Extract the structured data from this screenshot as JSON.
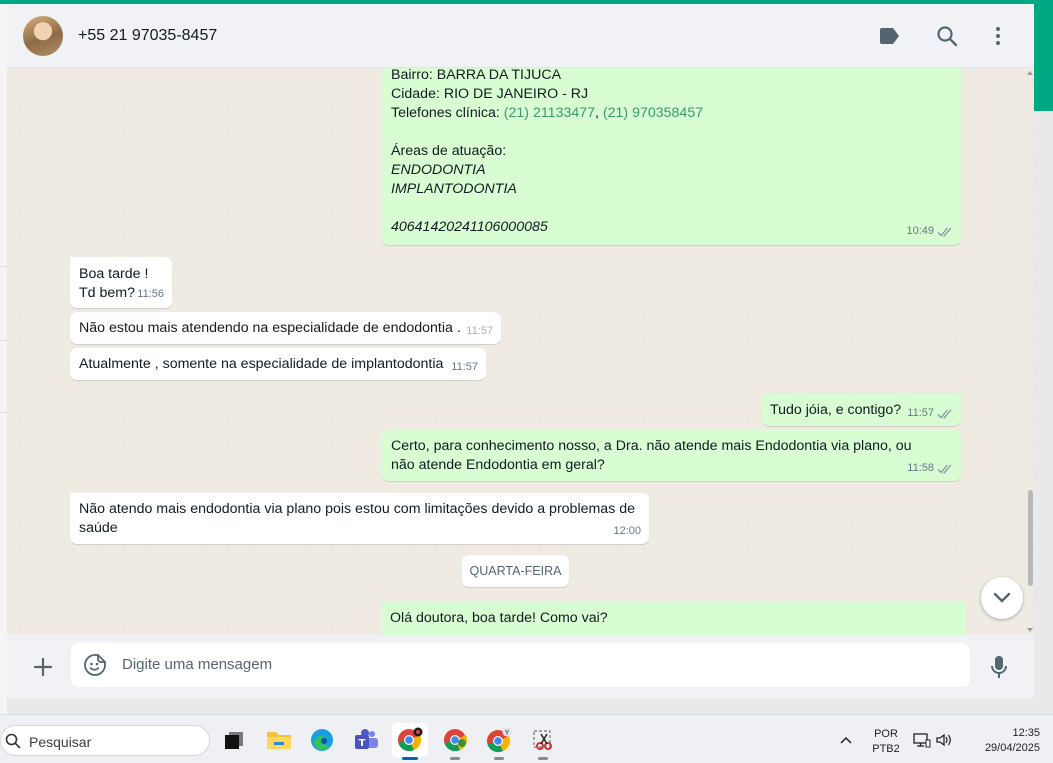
{
  "contact": {
    "name": "+55 21 97035-8457"
  },
  "messages": {
    "m1": {
      "line1": "Bairro: BARRA DA TIJUCA",
      "line2": "Cidade: RIO DE JANEIRO - RJ",
      "line3_prefix": "Telefones clínica: ",
      "phone1": "(21) 21133477",
      "sep": ", ",
      "phone2": "(21) 970358457",
      "areas_label": "Áreas de atuação:",
      "area1": "ENDODONTIA",
      "area2": "IMPLANTODONTIA",
      "code": "40641420241106000085",
      "time": "10:49"
    },
    "m2": {
      "line1": "Boa tarde !",
      "line2": "Td bem?",
      "time": "11:56"
    },
    "m3": {
      "text": "Não estou mais atendendo na especialidade de endodontia .",
      "time": "11:57"
    },
    "m4": {
      "text": "Atualmente , somente na especialidade de implantodontia",
      "time": "11:57"
    },
    "m5": {
      "text": "Tudo jóia, e contigo?",
      "time": "11:57"
    },
    "m6": {
      "text": "Certo, para conhecimento nosso, a Dra. não atende mais Endodontia via plano, ou não atende Endodontia em geral?",
      "time": "11:58"
    },
    "m7": {
      "text": "Não atendo mais endodontia via plano  pois estou com limitações devido a problemas de saúde",
      "time": "12:00"
    },
    "m8": {
      "text": "Olá doutora, boa tarde! Como vai?"
    }
  },
  "day_separator": "QUARTA-FEIRA",
  "composer": {
    "placeholder": "Digite uma mensagem"
  },
  "icons": {
    "label": "label-icon",
    "search": "search-icon",
    "menu": "menu-icon",
    "plus": "plus-icon",
    "emoji": "sticker-icon",
    "mic": "mic-icon",
    "scroll_down": "chevron-down-icon",
    "read_receipt": "double-check-icon"
  },
  "taskbar": {
    "search_label": "Pesquisar",
    "lang_line1": "POR",
    "lang_line2": "PTB2",
    "time": "12:35",
    "date": "29/04/2025"
  },
  "colors": {
    "accent": "#00a884",
    "outgoing_bubble": "#d9fdd3",
    "incoming_bubble": "#ffffff",
    "chat_bg": "#efeae2",
    "tick": "#8696a0"
  }
}
